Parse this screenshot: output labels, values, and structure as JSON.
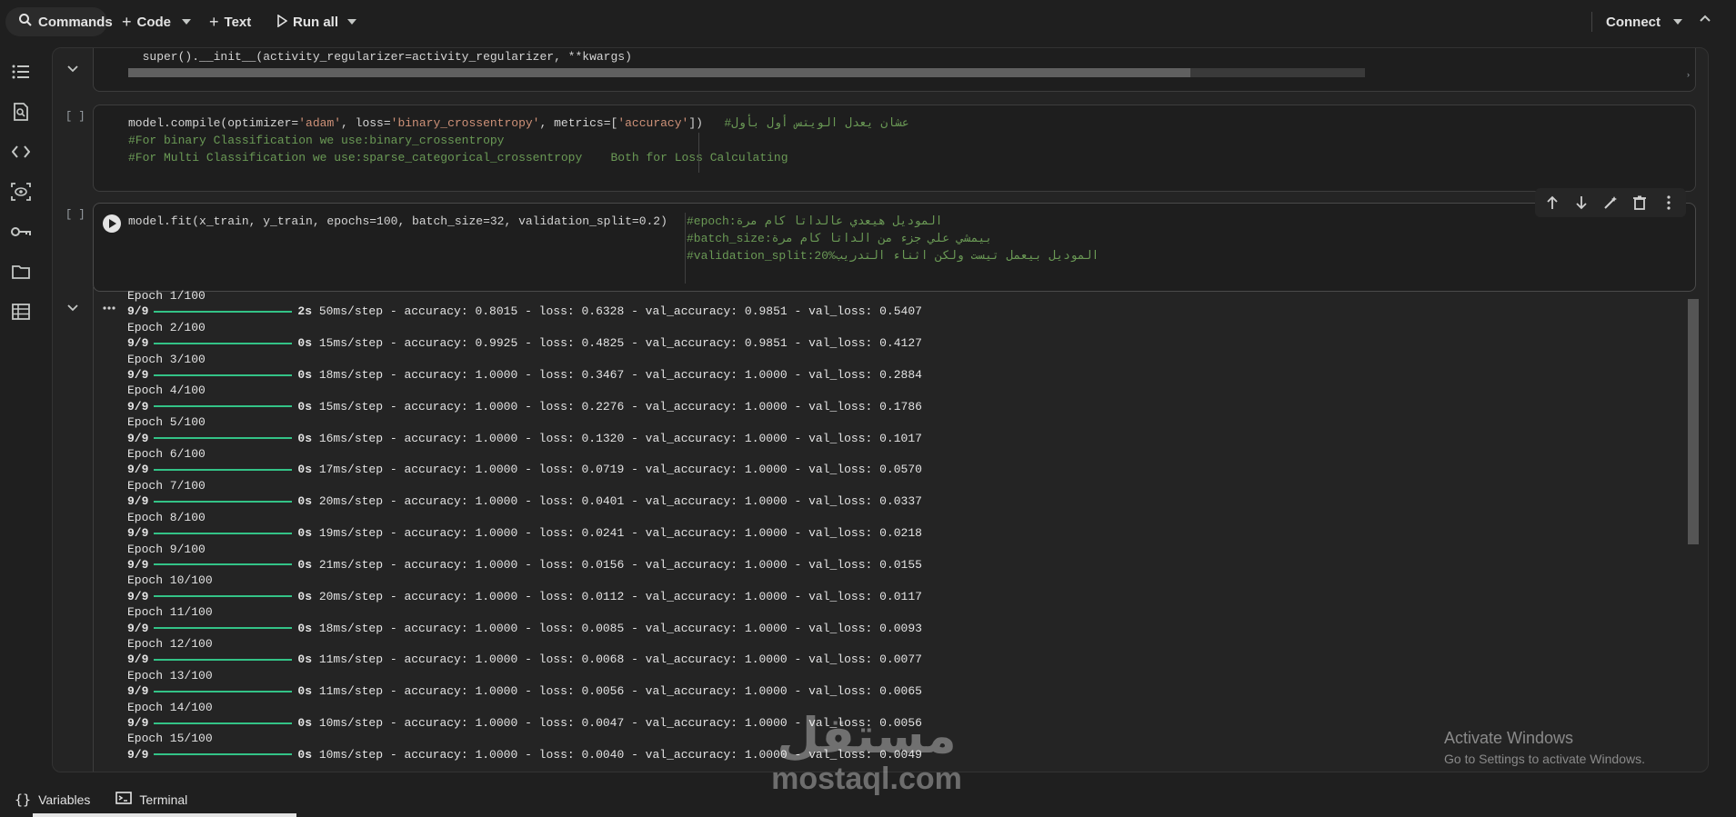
{
  "toolbar": {
    "commands": "Commands",
    "code": "Code",
    "text": "Text",
    "run_all": "Run all",
    "connect": "Connect"
  },
  "cell1": {
    "bracket": "[ ]",
    "line1": "model.compile(optimizer=",
    "str1": "'adam'",
    "line1b": ", loss=",
    "str2": "'binary_crossentropy'",
    "line1c": ", metrics=[",
    "str3": "'accuracy'",
    "line1d": "])   ",
    "cmt1": "#عشان يعدل الويتس أول بأول",
    "cmt2": "#For binary Classification we use:binary_crossentropy",
    "cmt3": "#For Multi Classification we use:sparse_categorical_crossentropy    Both for Loss Calculating"
  },
  "prev_output": {
    "line": "  super().__init__(activity_regularizer=activity_regularizer, **kwargs)"
  },
  "cell2": {
    "bracket": "[ ]",
    "code": "model.fit(x_train, y_train, epochs=100, batch_size=32, validation_split=0.2)",
    "cmt1": "#epoch:الموديل هيعدي عالداتا كام مرة",
    "cmt2": "#batch_size:بيمشي علي جزء من الداتا كام مرة",
    "cmt3": "#validation_split:20%الموديل بيعمل تيست ولكن اثناء التدريب"
  },
  "output": {
    "epochs": [
      {
        "epoch": "Epoch 1/100",
        "steps": "9/9",
        "time": "2s",
        "rest": "50ms/step - accuracy: 0.8015 - loss: 0.6328 - val_accuracy: 0.9851 - val_loss: 0.5407"
      },
      {
        "epoch": "Epoch 2/100",
        "steps": "9/9",
        "time": "0s",
        "rest": "15ms/step - accuracy: 0.9925 - loss: 0.4825 - val_accuracy: 0.9851 - val_loss: 0.4127"
      },
      {
        "epoch": "Epoch 3/100",
        "steps": "9/9",
        "time": "0s",
        "rest": "18ms/step - accuracy: 1.0000 - loss: 0.3467 - val_accuracy: 1.0000 - val_loss: 0.2884"
      },
      {
        "epoch": "Epoch 4/100",
        "steps": "9/9",
        "time": "0s",
        "rest": "15ms/step - accuracy: 1.0000 - loss: 0.2276 - val_accuracy: 1.0000 - val_loss: 0.1786"
      },
      {
        "epoch": "Epoch 5/100",
        "steps": "9/9",
        "time": "0s",
        "rest": "16ms/step - accuracy: 1.0000 - loss: 0.1320 - val_accuracy: 1.0000 - val_loss: 0.1017"
      },
      {
        "epoch": "Epoch 6/100",
        "steps": "9/9",
        "time": "0s",
        "rest": "17ms/step - accuracy: 1.0000 - loss: 0.0719 - val_accuracy: 1.0000 - val_loss: 0.0570"
      },
      {
        "epoch": "Epoch 7/100",
        "steps": "9/9",
        "time": "0s",
        "rest": "20ms/step - accuracy: 1.0000 - loss: 0.0401 - val_accuracy: 1.0000 - val_loss: 0.0337"
      },
      {
        "epoch": "Epoch 8/100",
        "steps": "9/9",
        "time": "0s",
        "rest": "19ms/step - accuracy: 1.0000 - loss: 0.0241 - val_accuracy: 1.0000 - val_loss: 0.0218"
      },
      {
        "epoch": "Epoch 9/100",
        "steps": "9/9",
        "time": "0s",
        "rest": "21ms/step - accuracy: 1.0000 - loss: 0.0156 - val_accuracy: 1.0000 - val_loss: 0.0155"
      },
      {
        "epoch": "Epoch 10/100",
        "steps": "9/9",
        "time": "0s",
        "rest": "20ms/step - accuracy: 1.0000 - loss: 0.0112 - val_accuracy: 1.0000 - val_loss: 0.0117"
      },
      {
        "epoch": "Epoch 11/100",
        "steps": "9/9",
        "time": "0s",
        "rest": "18ms/step - accuracy: 1.0000 - loss: 0.0085 - val_accuracy: 1.0000 - val_loss: 0.0093"
      },
      {
        "epoch": "Epoch 12/100",
        "steps": "9/9",
        "time": "0s",
        "rest": "11ms/step - accuracy: 1.0000 - loss: 0.0068 - val_accuracy: 1.0000 - val_loss: 0.0077"
      },
      {
        "epoch": "Epoch 13/100",
        "steps": "9/9",
        "time": "0s",
        "rest": "11ms/step - accuracy: 1.0000 - loss: 0.0056 - val_accuracy: 1.0000 - val_loss: 0.0065"
      },
      {
        "epoch": "Epoch 14/100",
        "steps": "9/9",
        "time": "0s",
        "rest": "10ms/step - accuracy: 1.0000 - loss: 0.0047 - val_accuracy: 1.0000 - val_loss: 0.0056"
      },
      {
        "epoch": "Epoch 15/100",
        "steps": "9/9",
        "time": "0s",
        "rest": "10ms/step - accuracy: 1.0000 - loss: 0.0040 - val_accuracy: 1.0000 - val_loss: 0.0049"
      }
    ]
  },
  "statusbar": {
    "variables": "Variables",
    "terminal": "Terminal"
  },
  "windows_watermark": {
    "title": "Activate Windows",
    "subtitle": "Go to Settings to activate Windows."
  },
  "logo_watermark": {
    "arabic": "مستقل",
    "latin": "mostaql.com"
  },
  "colors": {
    "progress": "#33c387",
    "string": "#ce9178",
    "comment": "#6a9955"
  }
}
